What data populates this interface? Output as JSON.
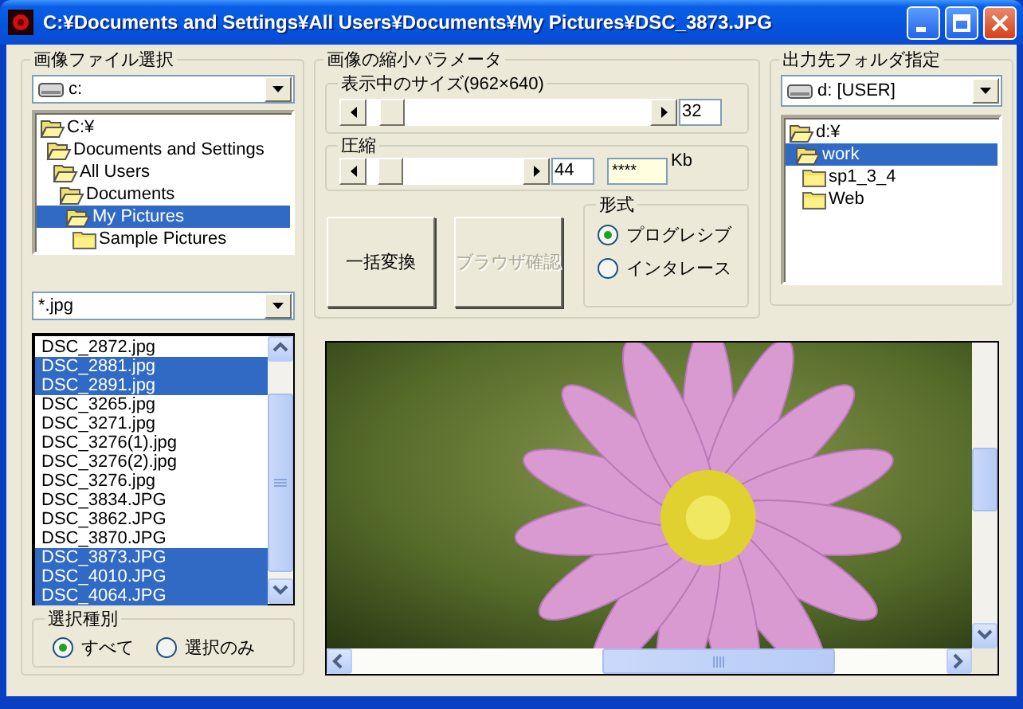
{
  "window": {
    "title": "C:¥Documents and Settings¥All Users¥Documents¥My Pictures¥DSC_3873.JPG"
  },
  "source": {
    "title": "画像ファイル選択",
    "drive": "c:",
    "folders": [
      {
        "label": "C:¥",
        "selected": false,
        "children": [
          {
            "label": "Documents and Settings",
            "selected": false,
            "children": [
              {
                "label": "All Users",
                "selected": false,
                "children": [
                  {
                    "label": "Documents",
                    "selected": false,
                    "children": [
                      {
                        "label": "My Pictures",
                        "selected": true,
                        "children": [
                          {
                            "label": "Sample Pictures",
                            "selected": false
                          }
                        ]
                      }
                    ]
                  }
                ]
              }
            ]
          }
        ]
      }
    ],
    "filter": "*.jpg",
    "files": [
      {
        "name": "DSC_2872.jpg",
        "selected": false
      },
      {
        "name": "DSC_2881.jpg",
        "selected": true
      },
      {
        "name": "DSC_2891.jpg",
        "selected": true
      },
      {
        "name": "DSC_3265.jpg",
        "selected": false
      },
      {
        "name": "DSC_3271.jpg",
        "selected": false
      },
      {
        "name": "DSC_3276(1).jpg",
        "selected": false
      },
      {
        "name": "DSC_3276(2).jpg",
        "selected": false
      },
      {
        "name": "DSC_3276.jpg",
        "selected": false
      },
      {
        "name": "DSC_3834.JPG",
        "selected": false
      },
      {
        "name": "DSC_3862.JPG",
        "selected": false
      },
      {
        "name": "DSC_3870.JPG",
        "selected": false
      },
      {
        "name": "DSC_3873.JPG",
        "selected": true
      },
      {
        "name": "DSC_4010.JPG",
        "selected": true
      },
      {
        "name": "DSC_4064.JPG",
        "selected": true
      }
    ],
    "selection_mode": {
      "title": "選択種別",
      "options": [
        {
          "label": "すべて",
          "selected": true
        },
        {
          "label": "選択のみ",
          "selected": false
        }
      ]
    }
  },
  "params": {
    "title": "画像の縮小パラメータ",
    "size": {
      "title": "表示中のサイズ(962×640)",
      "level": 0.05,
      "value": "32"
    },
    "compression": {
      "title": "圧縮",
      "level": 0.08,
      "value": "44",
      "estimate": "****",
      "unit": "Kb"
    },
    "buttons": [
      {
        "label": "一括変換",
        "disabled": false
      },
      {
        "label": "ブラウザ確認",
        "disabled": true
      }
    ],
    "format": {
      "title": "形式",
      "options": [
        {
          "label": "プログレシブ",
          "selected": true
        },
        {
          "label": "インタレース",
          "selected": false
        }
      ]
    }
  },
  "output": {
    "title": "出力先フォルダ指定",
    "drive": "d: [USER]",
    "folders": [
      {
        "label": "d:¥",
        "selected": false,
        "children": [
          {
            "label": "work",
            "selected": true,
            "children": [
              {
                "label": "sp1_3_4",
                "selected": false
              },
              {
                "label": "Web",
                "selected": false
              }
            ]
          }
        ]
      }
    ]
  }
}
